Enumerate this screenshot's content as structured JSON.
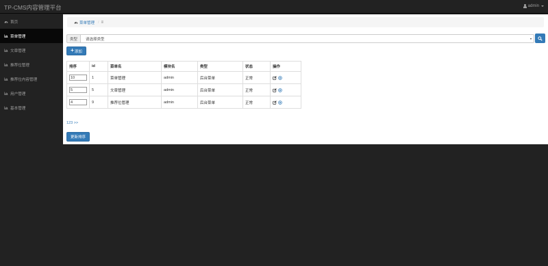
{
  "topbar": {
    "brand": "TP-CMS内容管理平台",
    "user": "admin"
  },
  "sidebar": {
    "items": [
      {
        "label": "首页",
        "icon": "dashboard-icon",
        "active": false
      },
      {
        "label": "菜单管理",
        "icon": "bar-chart-icon",
        "active": true
      },
      {
        "label": "文章管理",
        "icon": "bar-chart-icon",
        "active": false
      },
      {
        "label": "推荐位管理",
        "icon": "bar-chart-icon",
        "active": false
      },
      {
        "label": "推荐位内容管理",
        "icon": "bar-chart-icon",
        "active": false
      },
      {
        "label": "用户管理",
        "icon": "bar-chart-icon",
        "active": false
      },
      {
        "label": "基本管理",
        "icon": "bar-chart-icon",
        "active": false
      }
    ]
  },
  "breadcrumb": {
    "current": "菜单管理"
  },
  "filter": {
    "label": "类型",
    "selected": "请选择类型"
  },
  "toolbar": {
    "add_label": "添加",
    "update_sort_label": "更新排序"
  },
  "table": {
    "headers": [
      "排序",
      "id",
      "菜单名",
      "模块名",
      "类型",
      "状态",
      "操作"
    ],
    "rows": [
      {
        "sort": "10",
        "id": "1",
        "name": "菜单管理",
        "module": "admin",
        "type": "后台菜单",
        "status": "正常"
      },
      {
        "sort": "5",
        "id": "5",
        "name": "文章管理",
        "module": "admin",
        "type": "后台菜单",
        "status": "正常"
      },
      {
        "sort": "4",
        "id": "9",
        "name": "推荐位管理",
        "module": "admin",
        "type": "后台菜单",
        "status": "正常"
      }
    ]
  },
  "pagination": {
    "text": "123 >>"
  },
  "colors": {
    "primary": "#337ab7",
    "navbar": "#222222",
    "active_nav": "#080808"
  }
}
